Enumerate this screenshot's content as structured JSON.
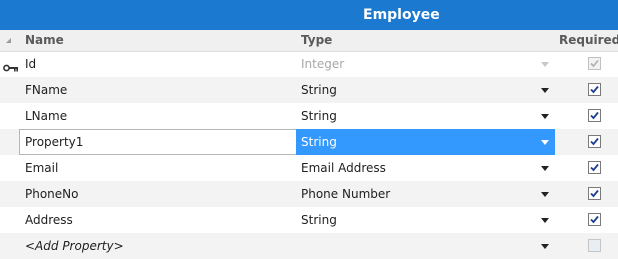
{
  "entity": {
    "title": "Employee"
  },
  "columns": {
    "name": "Name",
    "type": "Type",
    "required": "Required"
  },
  "rows": [
    {
      "name": "Id",
      "type": "Integer",
      "required": true,
      "key": true,
      "disabled": true
    },
    {
      "name": "FName",
      "type": "String",
      "required": true
    },
    {
      "name": "LName",
      "type": "String",
      "required": true
    },
    {
      "name": "Property1",
      "type": "String",
      "required": true,
      "selected": true
    },
    {
      "name": "Email",
      "type": "Email Address",
      "required": true
    },
    {
      "name": "PhoneNo",
      "type": "Phone Number",
      "required": true
    },
    {
      "name": "Address",
      "type": "String",
      "required": true
    }
  ],
  "add_row": {
    "label": "<Add Property>",
    "required": false
  },
  "icons": {
    "key": "key-icon",
    "dropdown": "chevron-down-icon",
    "check": "check-icon"
  },
  "colors": {
    "title_bg": "#1b79cf",
    "selection": "#3399ff"
  }
}
